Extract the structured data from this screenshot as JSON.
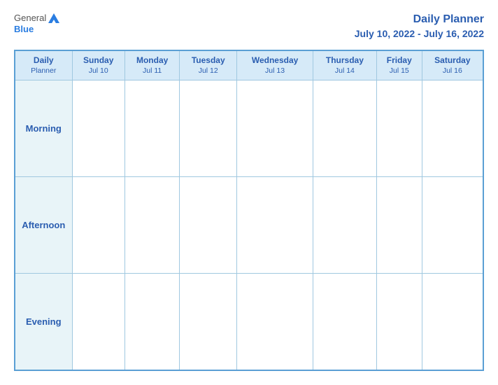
{
  "header": {
    "logo": {
      "general": "General",
      "blue": "Blue",
      "triangle_alt": "GeneralBlue logo"
    },
    "title": "Daily Planner",
    "date_range": "July 10, 2022 - July 16, 2022"
  },
  "table": {
    "header_planner": {
      "line1": "Daily",
      "line2": "Planner"
    },
    "columns": [
      {
        "day": "Sunday",
        "date": "Jul 10"
      },
      {
        "day": "Monday",
        "date": "Jul 11"
      },
      {
        "day": "Tuesday",
        "date": "Jul 12"
      },
      {
        "day": "Wednesday",
        "date": "Jul 13"
      },
      {
        "day": "Thursday",
        "date": "Jul 14"
      },
      {
        "day": "Friday",
        "date": "Jul 15"
      },
      {
        "day": "Saturday",
        "date": "Jul 16"
      }
    ],
    "rows": [
      {
        "label": "Morning"
      },
      {
        "label": "Afternoon"
      },
      {
        "label": "Evening"
      }
    ]
  }
}
